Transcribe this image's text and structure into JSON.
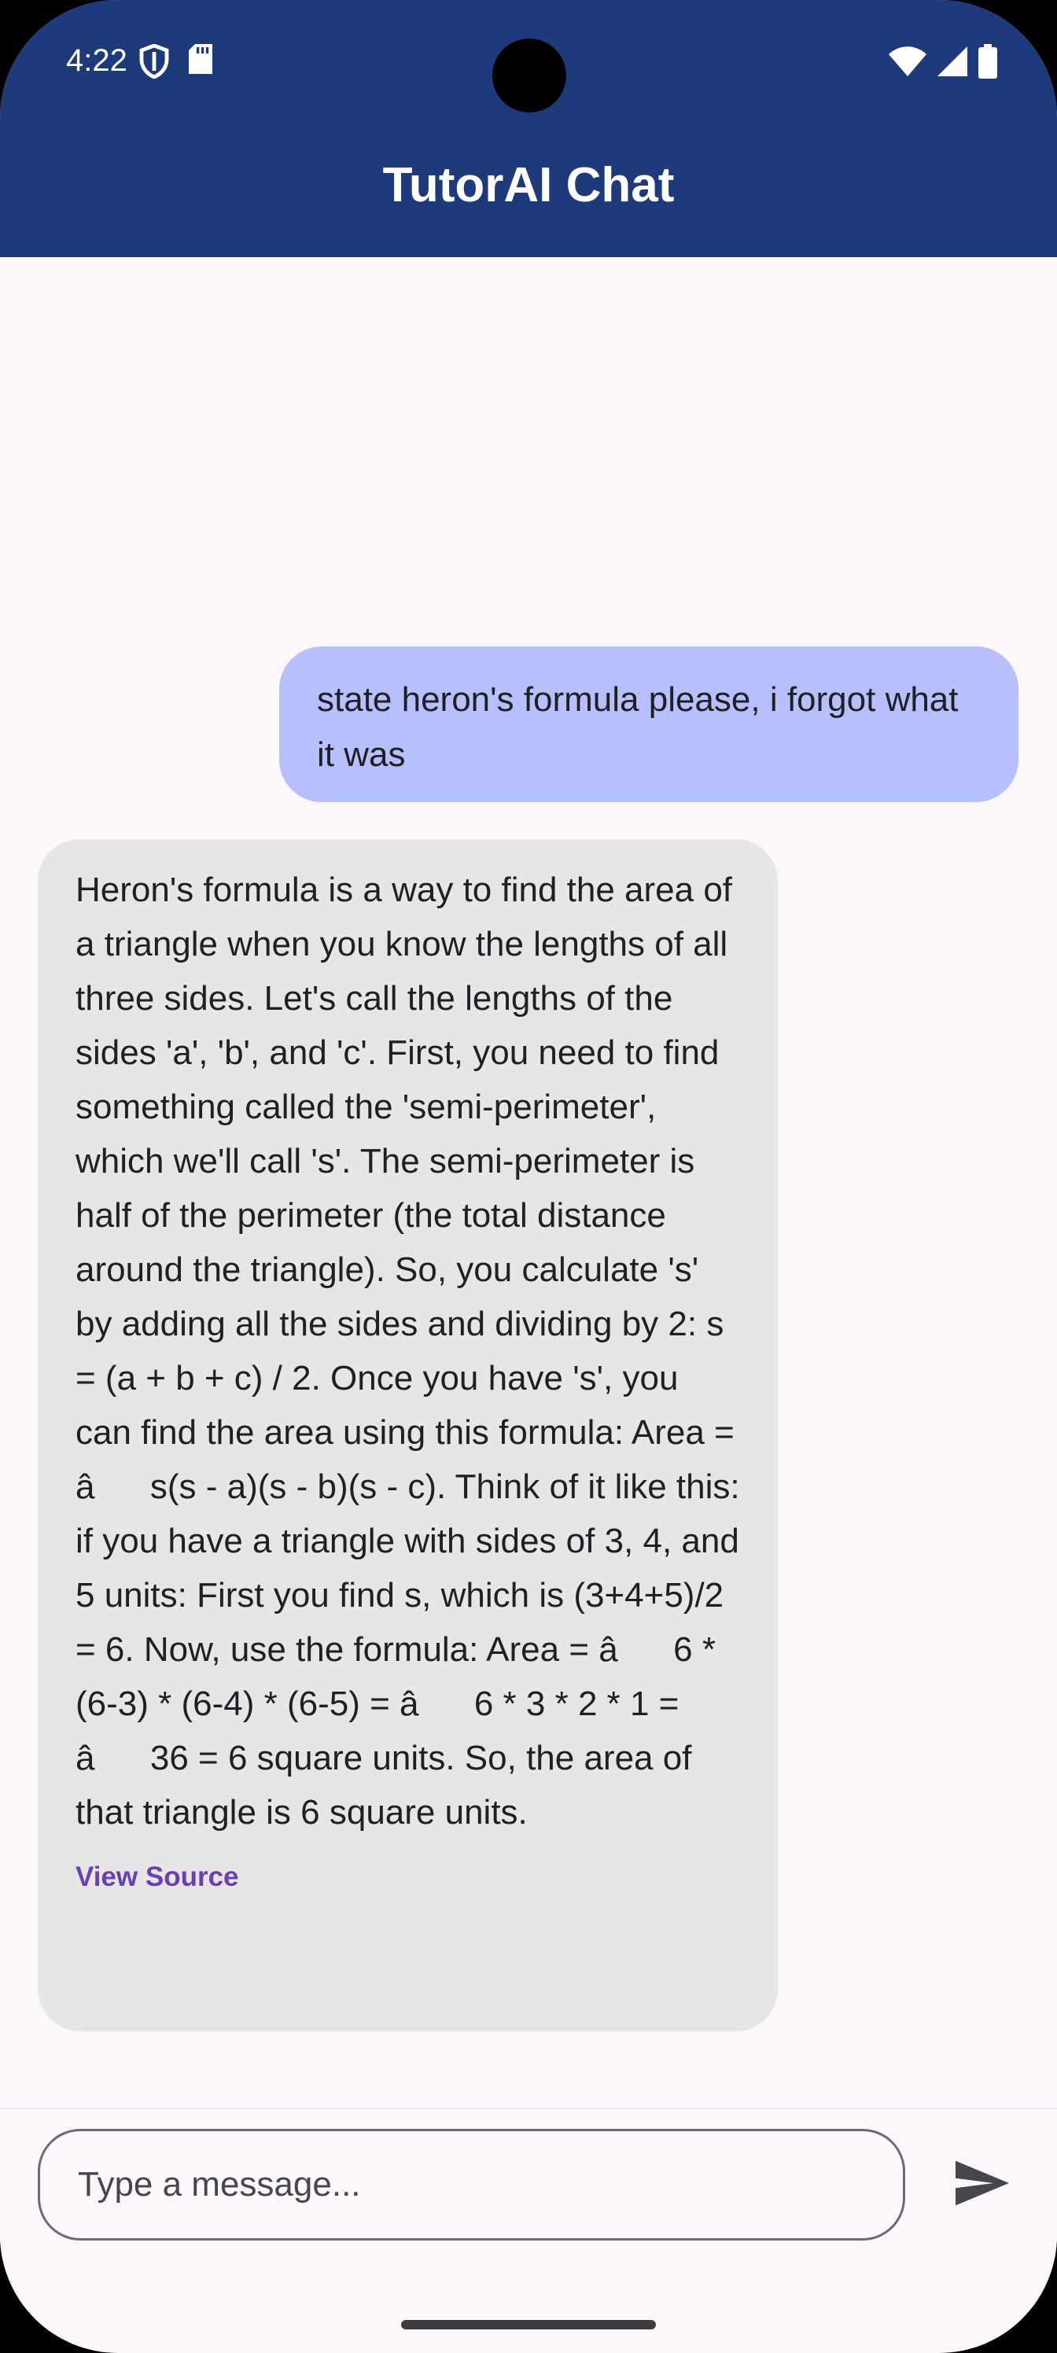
{
  "status_bar": {
    "time": "4:22",
    "left_icons": [
      "shield-icon",
      "sd-card-icon"
    ],
    "right_icons": [
      "wifi-icon",
      "cell-signal-icon",
      "battery-icon"
    ]
  },
  "app_bar": {
    "title": "TutorAI Chat"
  },
  "messages": [
    {
      "role": "user",
      "text": "state heron's formula please, i forgot what it was"
    },
    {
      "role": "assistant",
      "text": "Heron's formula is a way to find the area of a triangle when you know the lengths of all three sides. Let's call the lengths of the sides 'a', 'b', and 'c'. First, you need to find something called the 'semi-perimeter', which we'll call 's'. The semi-perimeter is half of the perimeter (the total distance around the triangle). So, you calculate 's' by adding all the sides and dividing by 2: s = (a + b + c) / 2. Once you have 's', you can find the area using this formula: Area = âs(s - a)(s - b)(s - c). Think of it like this: if you have a triangle with sides of 3, 4, and 5 units: First you find s, which is (3+4+5)/2 = 6. Now, use the formula: Area = â6 * (6-3) * (6-4) * (6-5) = â6 * 3 * 2 * 1 = â36 = 6 square units. So, the area of that triangle is 6 square units.",
      "link_label": "View Source"
    }
  ],
  "input": {
    "placeholder": "Type a message...",
    "send_icon": "send-icon"
  },
  "colors": {
    "app_bar": "#1e3a7b",
    "background": "#fdf7fc",
    "user_bubble": "#b7c0fc",
    "assistant_bubble": "#e6e6e6",
    "link": "#6b3fb4"
  }
}
